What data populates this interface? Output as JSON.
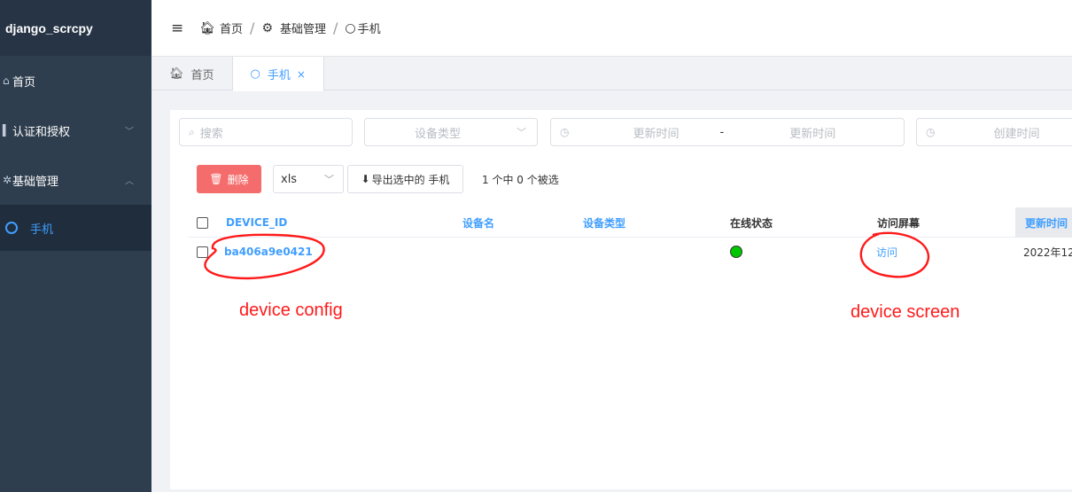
{
  "app": {
    "title": "django_scrcpy"
  },
  "sidebar": {
    "items": [
      {
        "label": "首页",
        "icon": "home-icon"
      },
      {
        "label": "认证和授权",
        "icon": "lock-icon",
        "arrow": "﹀"
      },
      {
        "label": "基础管理",
        "icon": "gear-icon",
        "arrow": "︿"
      }
    ],
    "sub_items": [
      {
        "label": "手机",
        "icon": "circle-icon"
      }
    ]
  },
  "header": {
    "breadcrumb": [
      {
        "label": "首页"
      },
      {
        "label": "基础管理"
      },
      {
        "label": "手机"
      }
    ]
  },
  "tabs": [
    {
      "label": "首页"
    },
    {
      "label": "手机",
      "close": "×"
    }
  ],
  "filters": {
    "search_placeholder": "搜索",
    "device_type_placeholder": "设备类型",
    "update_time_start": "更新时间",
    "update_time_sep": "-",
    "update_time_end": "更新时间",
    "create_time": "创建时间"
  },
  "toolbar": {
    "delete_label": "删除",
    "format_value": "xls",
    "export_label": "导出选中的 手机",
    "selection_info": "1 个中 0 个被选"
  },
  "table": {
    "columns": [
      "DEVICE_ID",
      "设备名",
      "设备类型",
      "在线状态",
      "访问屏幕",
      "更新时间"
    ],
    "rows": [
      {
        "device_id": "ba406a9e0421",
        "name": "",
        "type": "",
        "online": true,
        "online_color": "#00c800",
        "visit": "访问",
        "updated": "2022年12"
      }
    ]
  },
  "annotations": {
    "left": "device config",
    "right": "device screen",
    "color": "#ff1a1a"
  }
}
